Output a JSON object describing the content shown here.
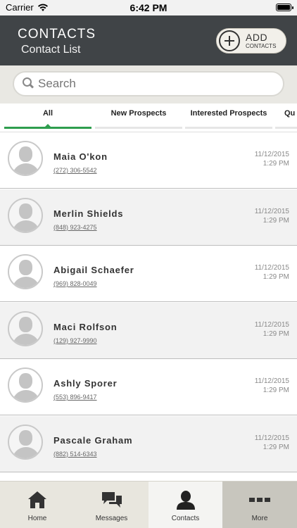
{
  "status_bar": {
    "carrier": "Carrier",
    "time": "6:42 PM"
  },
  "header": {
    "title": "CONTACTS",
    "subtitle": "Contact List",
    "add_button": {
      "label": "ADD",
      "sublabel": "CONTACTS"
    }
  },
  "search": {
    "placeholder": "Search"
  },
  "tabs": [
    {
      "label": "All",
      "active": true
    },
    {
      "label": "New Prospects",
      "active": false
    },
    {
      "label": "Interested Prospects",
      "active": false
    },
    {
      "label": "Qu",
      "active": false
    }
  ],
  "contacts": [
    {
      "name": "Maia O'kon",
      "phone": "(272) 306-5542",
      "date": "11/12/2015",
      "time": "1:29 PM"
    },
    {
      "name": "Merlin Shields",
      "phone": "(848) 923-4275",
      "date": "11/12/2015",
      "time": "1:29 PM"
    },
    {
      "name": "Abigail Schaefer",
      "phone": "(969) 828-0049",
      "date": "11/12/2015",
      "time": "1:29 PM"
    },
    {
      "name": "Maci Rolfson",
      "phone": "(129) 927-9990",
      "date": "11/12/2015",
      "time": "1:29 PM"
    },
    {
      "name": "Ashly Sporer",
      "phone": "(553) 896-9417",
      "date": "11/12/2015",
      "time": "1:29 PM"
    },
    {
      "name": "Pascale Graham",
      "phone": "(882) 514-6343",
      "date": "11/12/2015",
      "time": "1:29 PM"
    }
  ],
  "tabbar": [
    {
      "label": "Home",
      "icon": "home-icon"
    },
    {
      "label": "Messages",
      "icon": "messages-icon"
    },
    {
      "label": "Contacts",
      "icon": "contacts-icon",
      "active": true
    },
    {
      "label": "More",
      "icon": "more-icon"
    }
  ],
  "colors": {
    "header_bg": "#404447",
    "accent": "#2e9e4e",
    "tabbar_bg": "#e8e6de"
  }
}
